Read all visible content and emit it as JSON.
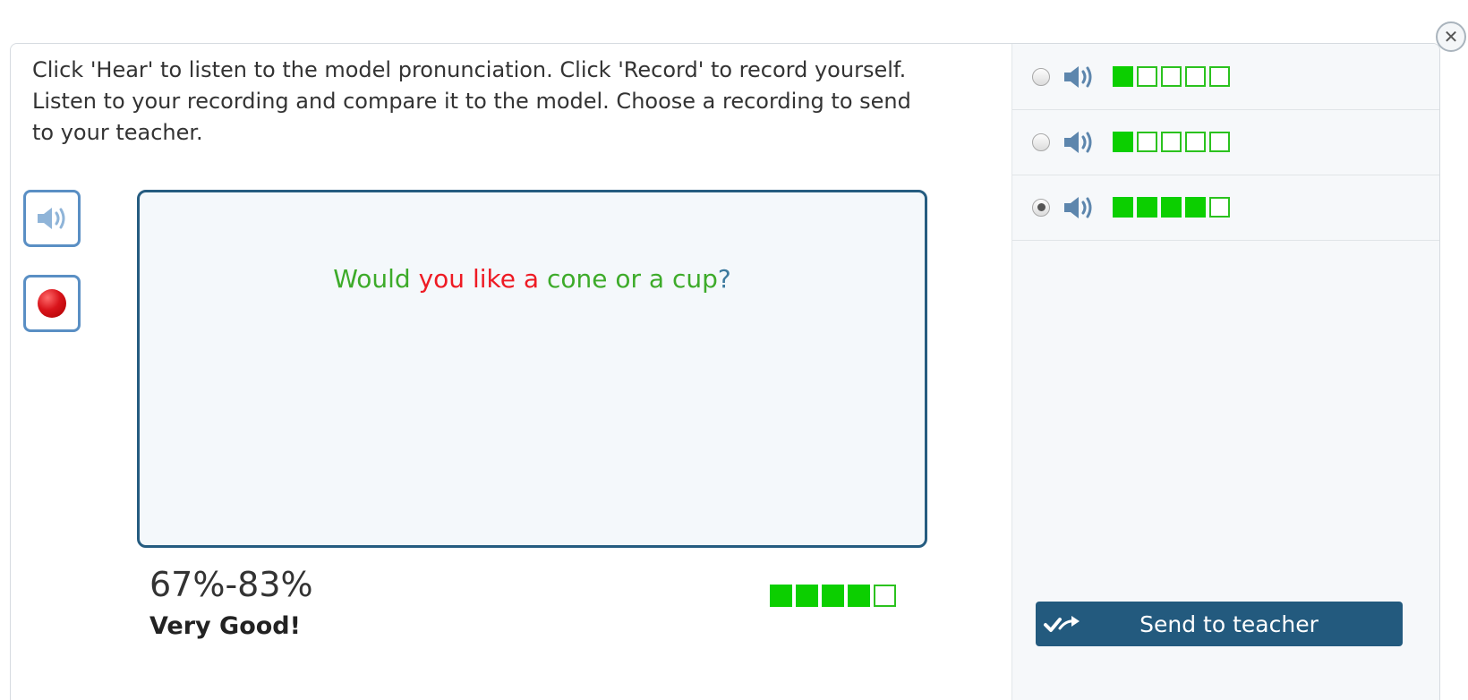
{
  "instructions": "Click 'Hear' to listen to the model pronunciation. Click 'Record' to record yourself. Listen to your recording and compare it to the model. Choose a recording to send to your teacher.",
  "sentence": [
    {
      "text": "Would",
      "status": "good"
    },
    {
      "text": "you",
      "status": "bad"
    },
    {
      "text": "like",
      "status": "bad"
    },
    {
      "text": "a",
      "status": "bad"
    },
    {
      "text": "cone",
      "status": "good"
    },
    {
      "text": "or",
      "status": "good"
    },
    {
      "text": "a",
      "status": "good"
    },
    {
      "text": "cup",
      "status": "good"
    },
    {
      "text": "?",
      "status": "punct"
    }
  ],
  "result": {
    "range": "67%-83%",
    "label": "Very Good!",
    "score_level": 4,
    "score_max": 5
  },
  "recordings": [
    {
      "score_level": 1,
      "selected": false
    },
    {
      "score_level": 1,
      "selected": false
    },
    {
      "score_level": 4,
      "selected": true
    }
  ],
  "send_button": {
    "label": "Send to teacher"
  },
  "colors": {
    "word_good": "#3dab2a",
    "word_bad": "#ee1b24",
    "meter_on": "#0ccf00",
    "accent": "#235a7e",
    "button_border": "#5a8fc4"
  },
  "icons": {
    "hear": "speaker-icon",
    "record": "record-icon",
    "close": "close-icon",
    "send": "check-arrow-icon"
  }
}
